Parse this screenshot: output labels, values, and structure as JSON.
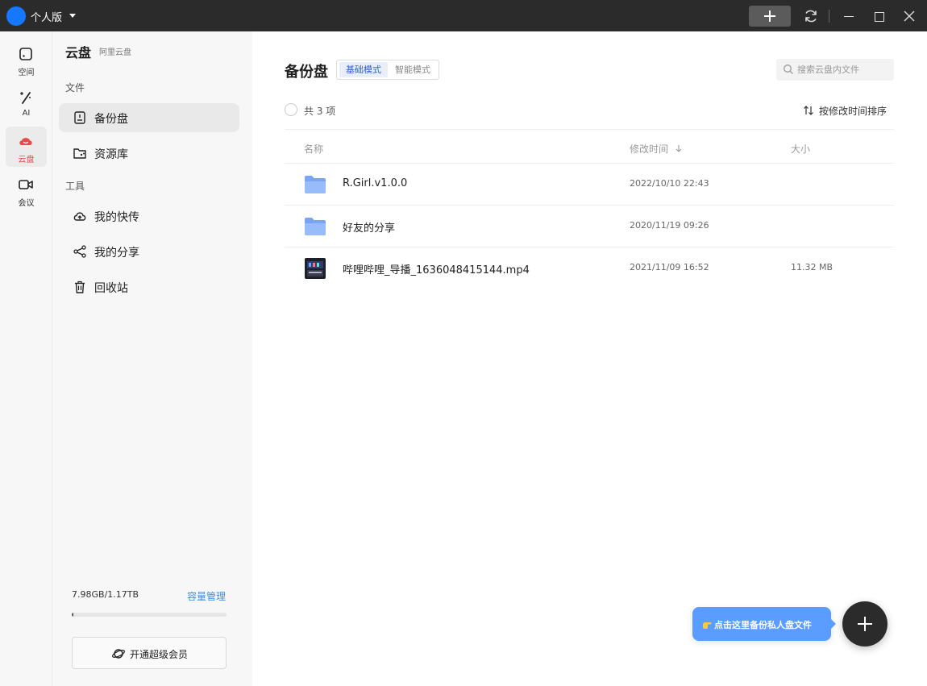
{
  "titlebar": {
    "edition": "个人版"
  },
  "rail": {
    "items": [
      {
        "label": "空间"
      },
      {
        "label": "AI"
      },
      {
        "label": "云盘"
      },
      {
        "label": "会议"
      }
    ],
    "active_color": "#e84a4a"
  },
  "sidebar": {
    "title": "云盘",
    "subtitle": "阿里云盘",
    "section_files": "文件",
    "section_tools": "工具",
    "items": [
      {
        "label": "备份盘",
        "icon": "backup-drive-icon"
      },
      {
        "label": "资源库",
        "icon": "folder-share-icon"
      },
      {
        "label": "我的快传",
        "icon": "cloud-upload-icon"
      },
      {
        "label": "我的分享",
        "icon": "share-icon"
      },
      {
        "label": "回收站",
        "icon": "trash-icon"
      }
    ],
    "storage": {
      "usage": "7.98GB/1.17TB",
      "used_fraction": 0.0067,
      "manage_label": "容量管理"
    },
    "vip_label": "开通超级会员"
  },
  "main": {
    "title": "备份盘",
    "modes": {
      "basic": "基础模式",
      "smart": "智能模式"
    },
    "search": {
      "placeholder": "搜索云盘内文件",
      "value": ""
    },
    "count_text": "共 3 项",
    "sort_label": "按修改时间排序",
    "columns": {
      "name": "名称",
      "modified": "修改时间",
      "size": "大小"
    },
    "rows": [
      {
        "name": "R.Girl.v1.0.0",
        "modified": "2022/10/10 22:43",
        "size": "",
        "icon": "folder-icon"
      },
      {
        "name": "好友的分享",
        "modified": "2020/11/19 09:26",
        "size": "",
        "icon": "folder-icon"
      },
      {
        "name": "哔哩哔哩_导播_1636048415144.mp4",
        "modified": "2021/11/09 16:52",
        "size": "11.32 MB",
        "icon": "video-thumbnail-icon"
      }
    ]
  },
  "tip": {
    "text": "点击这里备份私人盘文件"
  },
  "colors": {
    "accent_blue": "#1677ff",
    "tip_blue": "#5a9cff",
    "link_blue": "#3a8ee6",
    "dark": "#2b2b2b"
  }
}
